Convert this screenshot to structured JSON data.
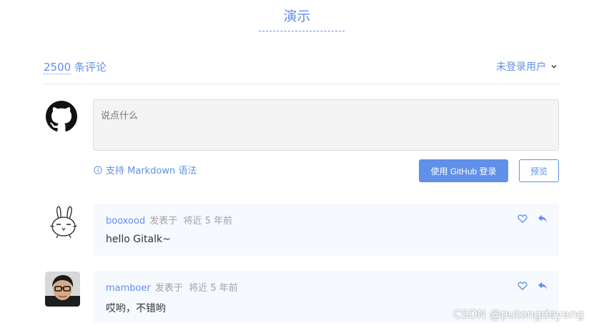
{
  "page": {
    "title": "演示"
  },
  "header": {
    "comment_count": "2500",
    "comment_suffix": " 条评论",
    "user_menu_label": "未登录用户",
    "chevron_icon": "chevron-down-icon"
  },
  "editor": {
    "placeholder": "说点什么",
    "markdown_tip": "支持 Markdown 语法",
    "info_icon": "info-icon",
    "login_button": "使用 GitHub 登录",
    "preview_button": "预览",
    "avatar_icon": "github-icon"
  },
  "comments": [
    {
      "author": "booxood",
      "published_label": "发表于",
      "time": "将近 5 年前",
      "body": "hello Gitalk~"
    },
    {
      "author": "mamboer",
      "published_label": "发表于",
      "time": "将近 5 年前",
      "body": "哎哟，不错哟"
    }
  ],
  "watermark": "CSDN @putongdeyang",
  "colors": {
    "accent": "#6190e8",
    "comment_bg": "#f6f9fe",
    "divider": "#e9e9e9"
  }
}
